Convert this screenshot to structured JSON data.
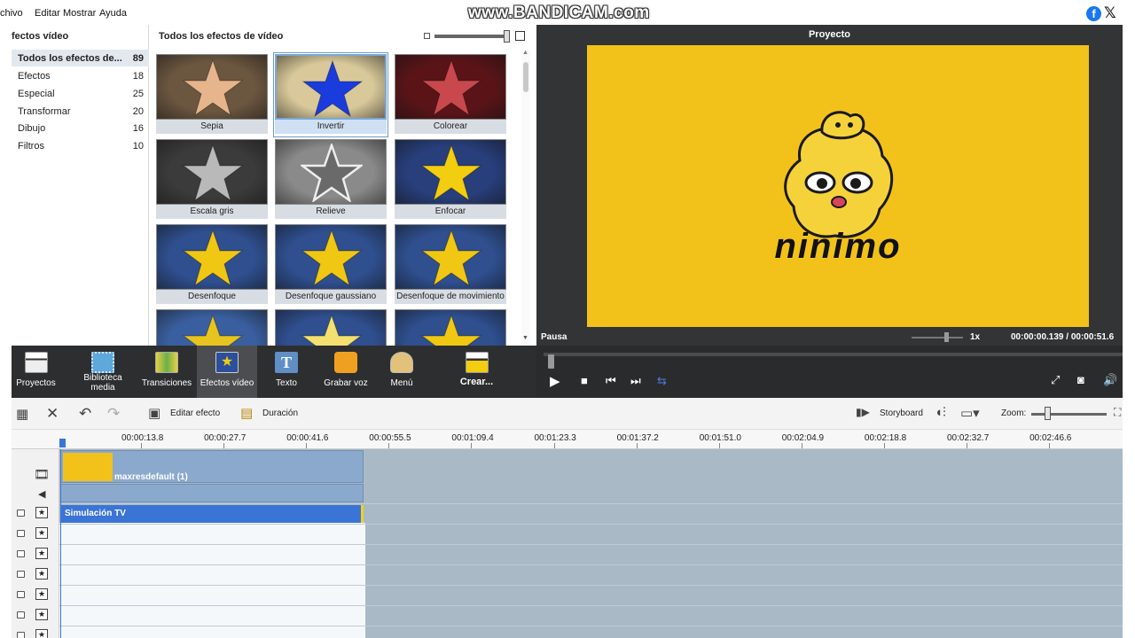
{
  "menu": {
    "items": [
      "chivo",
      "Editar",
      "Mostrar",
      "Ayuda"
    ]
  },
  "watermark": "www.BANDICAM.com",
  "categories": {
    "title": "fectos vídeo",
    "items": [
      {
        "label": "Todos los efectos de...",
        "count": "89"
      },
      {
        "label": "Efectos",
        "count": "18"
      },
      {
        "label": "Especial",
        "count": "25"
      },
      {
        "label": "Transformar",
        "count": "20"
      },
      {
        "label": "Dibujo",
        "count": "16"
      },
      {
        "label": "Filtros",
        "count": "10"
      }
    ]
  },
  "effects": {
    "title": "Todos los efectos de vídeo",
    "tiles": [
      {
        "label": "Sepia",
        "bg": "#6b5640",
        "star": "#e7b58c"
      },
      {
        "label": "Invertir",
        "bg": "#d9c99a",
        "star": "#1a3cdc"
      },
      {
        "label": "Colorear",
        "bg": "#5a1418",
        "star": "#c8484e"
      },
      {
        "label": "Escala gris",
        "bg": "#3b3b3b",
        "star": "#b9b9b9"
      },
      {
        "label": "Relieve",
        "bg": "#8a8a8a",
        "star": "#6a6a6a"
      },
      {
        "label": "Enfocar",
        "bg": "#283f7c",
        "star": "#f2cd10"
      },
      {
        "label": "Desenfoque",
        "bg": "#2f4f8f",
        "star": "#f0c814"
      },
      {
        "label": "Desenfoque gaussiano",
        "bg": "#2f4f8f",
        "star": "#f0c814"
      },
      {
        "label": "Desenfoque de movimiento",
        "bg": "#2f4f8f",
        "star": "#f0c814"
      },
      {
        "label": "",
        "bg": "#3a5fa0",
        "star": "#e8c420"
      },
      {
        "label": "",
        "bg": "#2f4f8f",
        "star": "#f4e070"
      },
      {
        "label": "",
        "bg": "#2f4f8f",
        "star": "#f0c814"
      }
    ]
  },
  "preview": {
    "title": "Proyecto",
    "brand": "ninimo",
    "status": "Pausa",
    "speed": "1x",
    "time": "00:00:00.139 / 00:00:51.6",
    "video_bg": "#f2c21b"
  },
  "toolbar": {
    "items": [
      {
        "label": "Proyectos",
        "icon": "clapperboard-icon"
      },
      {
        "label": "Biblioteca media",
        "icon": "film-icon"
      },
      {
        "label": "Transiciones",
        "icon": "transitions-icon"
      },
      {
        "label": "Efectos vídeo",
        "icon": "star-effect-icon"
      },
      {
        "label": "Texto",
        "icon": "text-icon"
      },
      {
        "label": "Grabar voz",
        "icon": "microphone-icon"
      },
      {
        "label": "Menú",
        "icon": "disc-menu-icon"
      },
      {
        "label": "Crear...",
        "icon": "create-icon"
      }
    ]
  },
  "timeline_toolbar": {
    "edit_effect": "Editar efecto",
    "duration": "Duración",
    "storyboard": "Storyboard",
    "zoom": "Zoom:"
  },
  "ruler": [
    "00:00:13.8",
    "00:00:27.7",
    "00:00:41.6",
    "00:00:55.5",
    "00:01:09.4",
    "00:01:23.3",
    "00:01:37.2",
    "00:01:51.0",
    "00:02:04.9",
    "00:02:18.8",
    "00:02:32.7",
    "00:02:46.6"
  ],
  "timeline": {
    "video_clip": "maxresdefault (1)",
    "effect_clip": "Simulación TV"
  },
  "colors": {
    "accent": "#3a74d6",
    "toolbar": "#2d2e30",
    "track": "#a9b9c6"
  }
}
